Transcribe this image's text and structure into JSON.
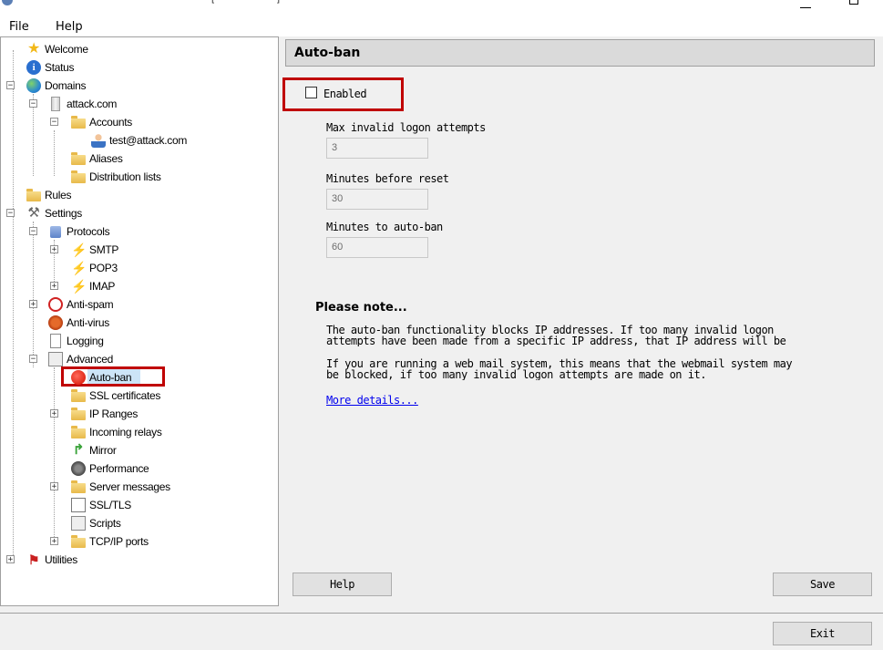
{
  "window": {
    "title_fragment_left": "[",
    "title_fragment_right": "]"
  },
  "menu": {
    "file": "File",
    "help": "Help"
  },
  "tree": {
    "welcome": "Welcome",
    "status": "Status",
    "domains": "Domains",
    "domain": "attack.com",
    "accounts": "Accounts",
    "account": "test@attack.com",
    "aliases": "Aliases",
    "distribution_lists": "Distribution lists",
    "rules": "Rules",
    "settings": "Settings",
    "protocols": "Protocols",
    "smtp": "SMTP",
    "pop3": "POP3",
    "imap": "IMAP",
    "anti_spam": "Anti-spam",
    "anti_virus": "Anti-virus",
    "logging": "Logging",
    "advanced": "Advanced",
    "auto_ban": "Auto-ban",
    "ssl_certificates": "SSL certificates",
    "ip_ranges": "IP Ranges",
    "incoming_relays": "Incoming relays",
    "mirror": "Mirror",
    "performance": "Performance",
    "server_messages": "Server messages",
    "ssl_tls": "SSL/TLS",
    "scripts": "Scripts",
    "tcp_ip_ports": "TCP/IP ports",
    "utilities": "Utilities",
    "expand_plus": "+",
    "collapse_minus": "−"
  },
  "panel": {
    "title": "Auto-ban",
    "enabled_label": "Enabled",
    "max_attempts_label": "Max invalid logon attempts",
    "max_attempts_value": "3",
    "minutes_reset_label": "Minutes before reset",
    "minutes_reset_value": "30",
    "minutes_ban_label": "Minutes to auto-ban",
    "minutes_ban_value": "60",
    "note_title": "Please note...",
    "note_p1": "The auto-ban functionality blocks IP addresses. If too many invalid logon\nattempts have been made from a specific IP address, that IP address will be",
    "note_p2": "If you are running a web mail system, this means that the webmail system may\nbe blocked, if too many invalid logon attempts are made on it.",
    "more_details": "More details...",
    "help_button": "Help",
    "save_button": "Save"
  },
  "footer": {
    "exit_button": "Exit"
  },
  "colors": {
    "highlight": "#c00000",
    "link": "#0000ee",
    "selection": "#cce4f7"
  }
}
